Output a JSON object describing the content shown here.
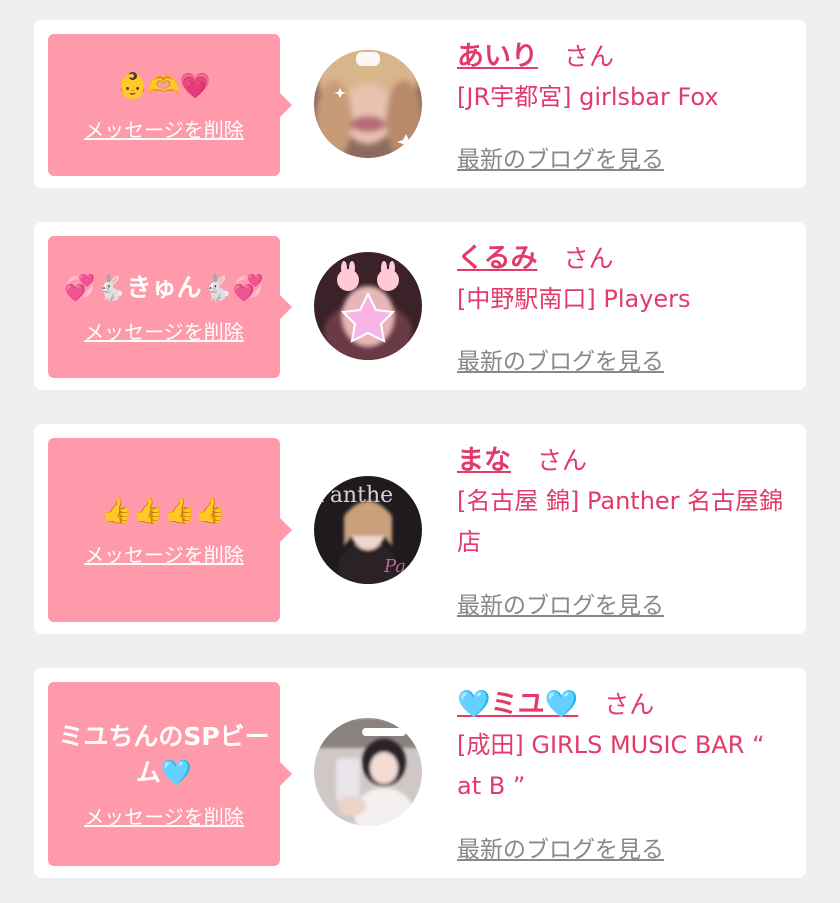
{
  "messages": [
    {
      "message": "👶🫶💗",
      "delete_label": "メッセージを削除",
      "name": "あいり",
      "honorific": "さん",
      "shop": "[JR宇都宮] girlsbar Fox",
      "blog_label": "最新のブログを見る"
    },
    {
      "message": "💞🐇きゅん🐇💞",
      "delete_label": "メッセージを削除",
      "name": "くるみ",
      "honorific": "さん",
      "shop": "[中野駅南口] Players",
      "blog_label": "最新のブログを見る"
    },
    {
      "message": "👍👍👍👍",
      "delete_label": "メッセージを削除",
      "name": "まな",
      "honorific": "さん",
      "shop": "[名古屋 錦] Panther 名古屋錦店",
      "blog_label": "最新のブログを見る"
    },
    {
      "message": "ミユちんのSPビーム🩵",
      "delete_label": "メッセージを削除",
      "name": "🩵ミユ🩵",
      "honorific": "さん",
      "shop": "[成田] GIRLS MUSIC BAR “ at B ”",
      "blog_label": "最新のブログを見る"
    }
  ]
}
